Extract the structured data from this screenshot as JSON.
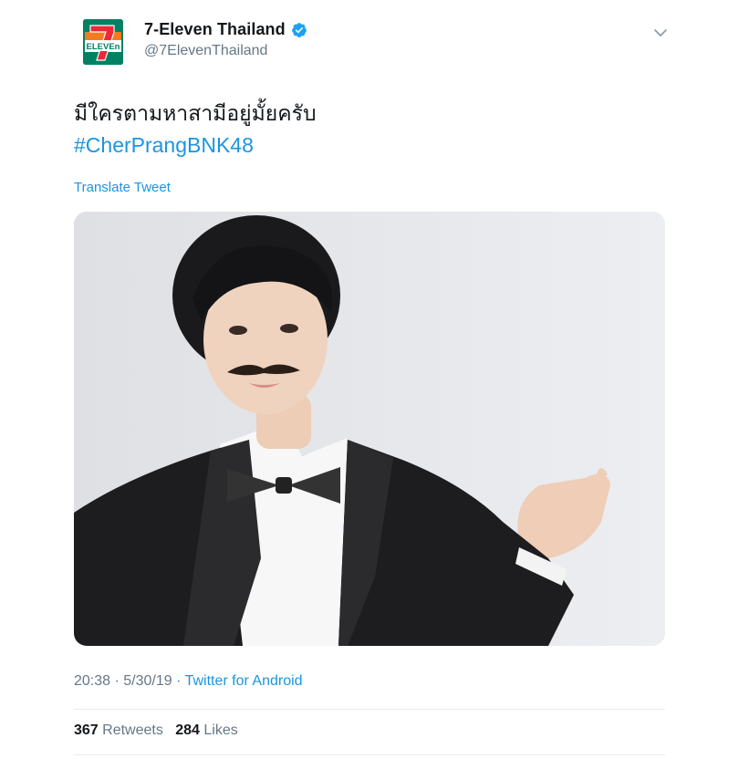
{
  "account": {
    "display_name": "7-Eleven Thailand",
    "handle": "@7ElevenThailand",
    "verified": true,
    "avatar_icon": "7-eleven-logo",
    "avatar_number": "7",
    "avatar_text": "ELEVEn"
  },
  "tweet": {
    "text": "มีใครตามหาสามีอยู่มั้ยครับ",
    "hashtag": "#CherPrangBNK48",
    "translate_label": "Translate Tweet"
  },
  "meta": {
    "time": "20:38",
    "separator": " · ",
    "date": "5/30/19",
    "source": "Twitter for Android"
  },
  "stats": {
    "retweets_count": "367",
    "retweets_label": "Retweets",
    "likes_count": "284",
    "likes_label": "Likes"
  },
  "colors": {
    "link": "#1b95e0",
    "secondary_text": "#657786",
    "verified_badge": "#1da1f2",
    "brand_green": "#008163",
    "brand_orange": "#f47b20",
    "brand_red": "#ee2737"
  }
}
